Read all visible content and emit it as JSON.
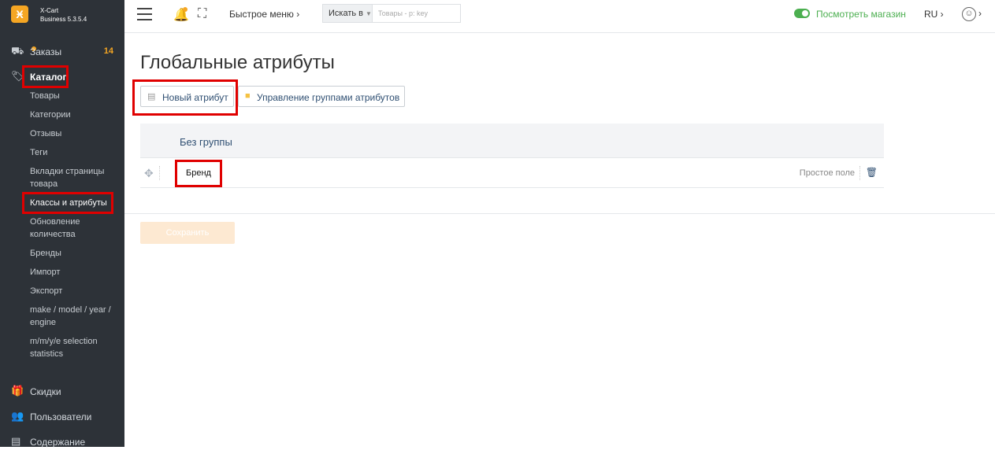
{
  "brand": {
    "logo_glyph": "Ӿ",
    "line1": "X-Cart",
    "line2": "Business 5.3.5.4"
  },
  "sidebar": {
    "orders": {
      "label": "Заказы",
      "count": "14"
    },
    "catalog": {
      "label": "Каталог"
    },
    "catalog_items": [
      "Товары",
      "Категории",
      "Отзывы",
      "Теги",
      "Вкладки страницы товара",
      "Классы и атрибуты",
      "Обновление количества",
      "Бренды",
      "Импорт",
      "Экспорт",
      "make / model / year / engine",
      "m/m/y/e selection statistics"
    ],
    "discounts": {
      "label": "Скидки"
    },
    "users": {
      "label": "Пользователи"
    },
    "content": {
      "label": "Содержание"
    }
  },
  "topbar": {
    "quick_menu": "Быстрое меню ›",
    "search_label": "Искать в",
    "search_placeholder": "Товары - р: key",
    "view_store": "Посмотреть магазин",
    "lang": "RU ›",
    "user_chevron": "›"
  },
  "main": {
    "title": "Глобальные атрибуты",
    "new_attribute": "Новый атрибут",
    "manage_groups": "Управление группами атрибутов",
    "group_label": "Без группы",
    "attribute_name": "Бренд",
    "attribute_type": "Простое поле",
    "save_label": "Сохранить"
  },
  "colors": {
    "accent": "#f5a623",
    "link": "#2f4f72",
    "green": "#4caf50",
    "highlight": "#e00000"
  }
}
